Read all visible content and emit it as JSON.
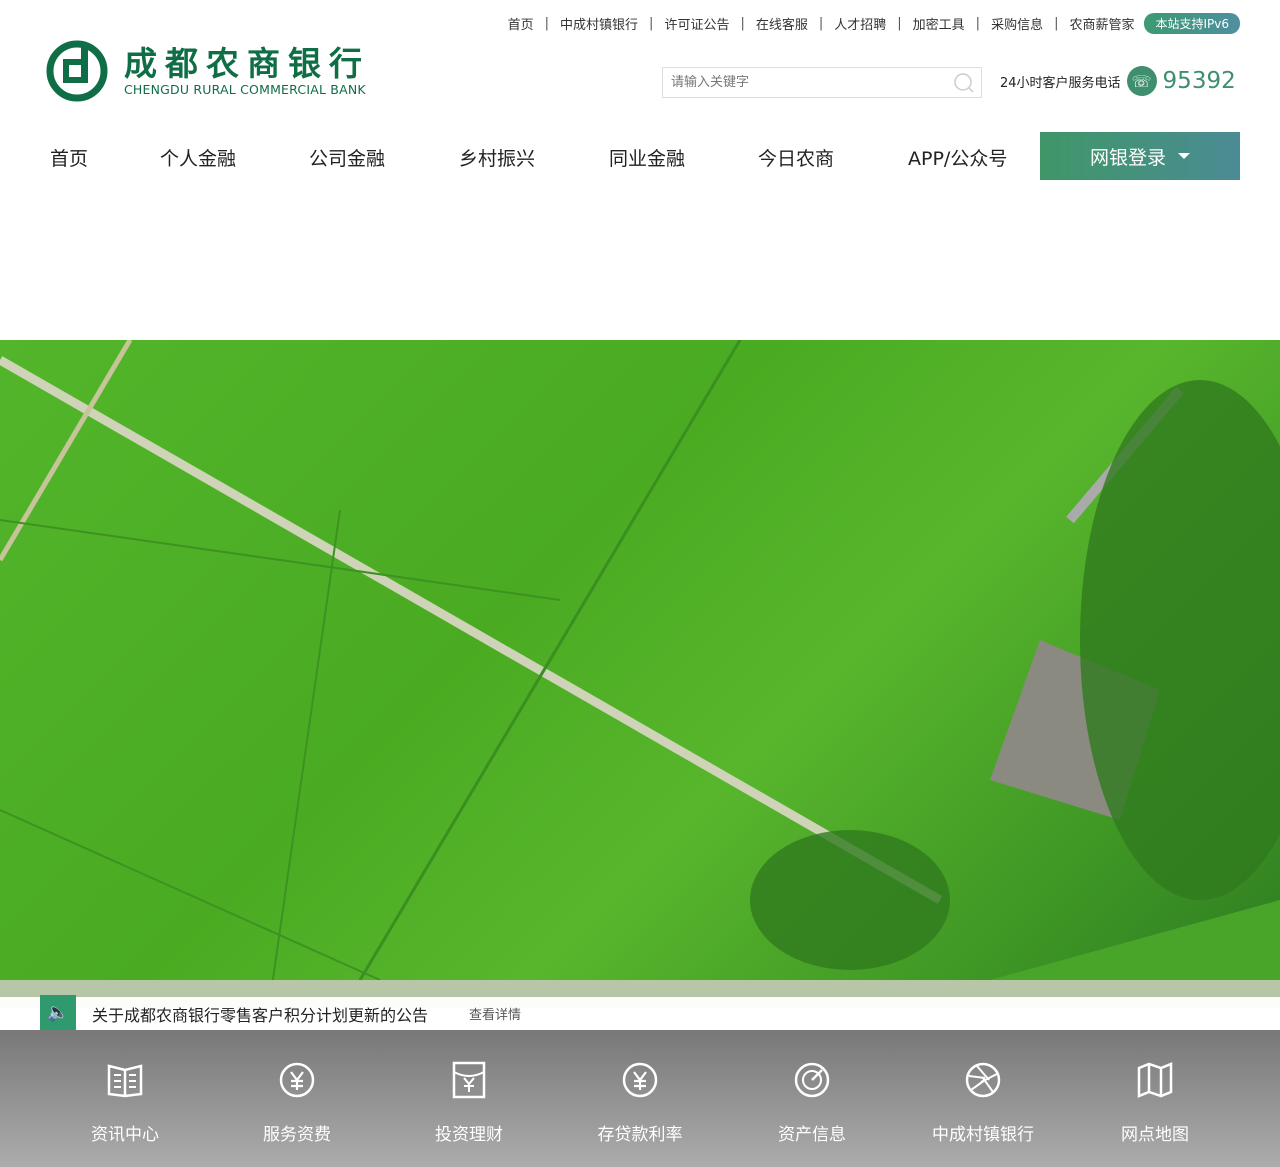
{
  "top_links": [
    "首页",
    "中成村镇银行",
    "许可证公告",
    "在线客服",
    "人才招聘",
    "加密工具",
    "采购信息",
    "农商薪管家"
  ],
  "ipv6_badge": "本站支持IPv6",
  "logo": {
    "cn": "成都农商银行",
    "en": "CHENGDU RURAL COMMERCIAL BANK"
  },
  "search": {
    "placeholder": "请输入关键字",
    "value": ""
  },
  "hotline": {
    "label": "24小时客户服务电话",
    "number": "95392"
  },
  "nav": [
    "首页",
    "个人金融",
    "公司金融",
    "乡村振兴",
    "同业金融",
    "今日农商",
    "APP/公众号"
  ],
  "login_label": "网银登录",
  "notice": {
    "text": "关于成都农商银行零售客户积分计划更新的公告",
    "more": "查看详情"
  },
  "quick_links": [
    {
      "label": "资讯中心",
      "icon": "book-icon"
    },
    {
      "label": "服务资费",
      "icon": "yuan-circle-icon"
    },
    {
      "label": "投资理财",
      "icon": "yuan-envelope-icon"
    },
    {
      "label": "存贷款利率",
      "icon": "yuan-circle-icon"
    },
    {
      "label": "资产信息",
      "icon": "radar-icon"
    },
    {
      "label": "中成村镇银行",
      "icon": "aperture-icon"
    },
    {
      "label": "网点地图",
      "icon": "map-icon"
    }
  ],
  "colors": {
    "brand": "#0f6e45",
    "accent": "#3f9768"
  }
}
